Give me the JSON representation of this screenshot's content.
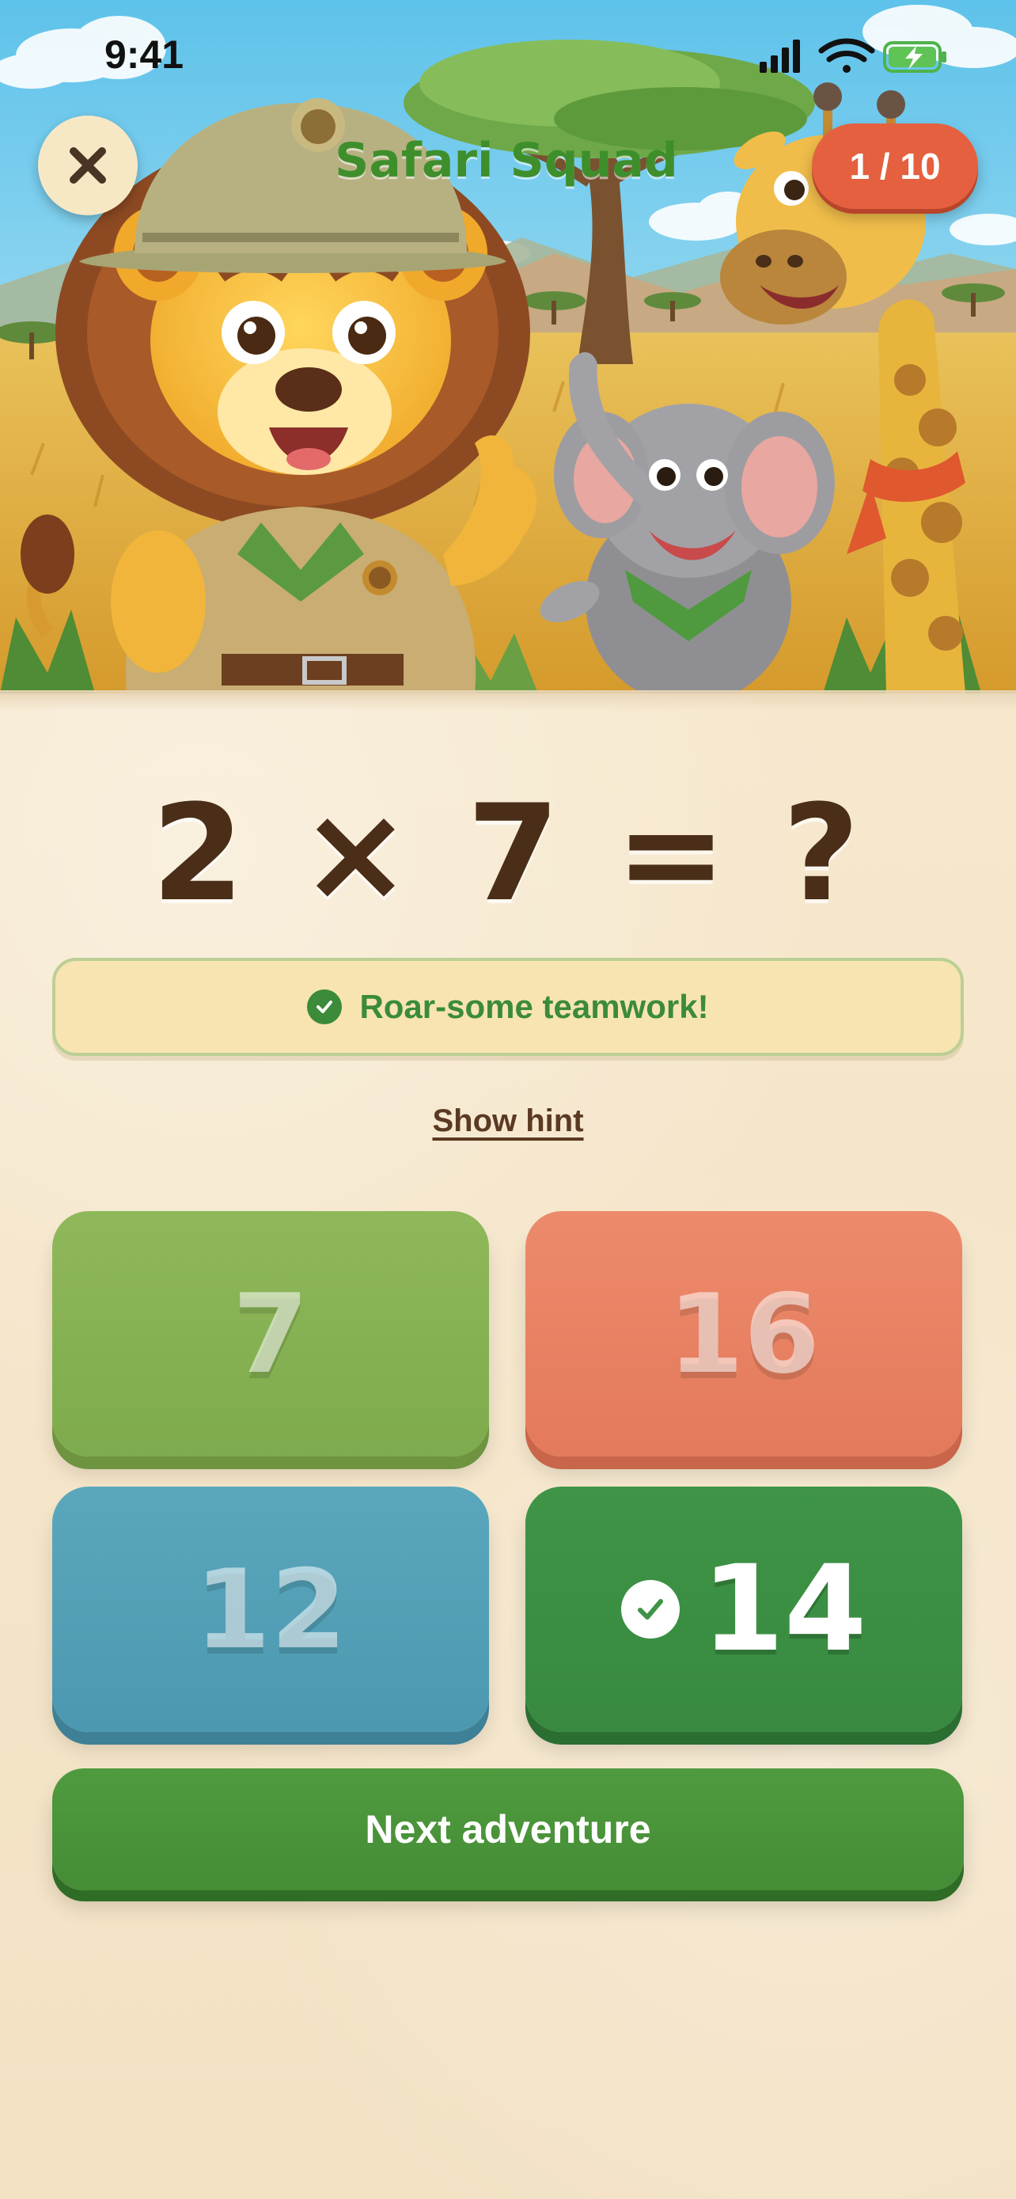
{
  "status_bar": {
    "time": "9:41"
  },
  "header": {
    "title": "Safari Squad",
    "progress": "1 / 10",
    "close_icon": "close-icon"
  },
  "question": {
    "text": "2 × 7 = ?"
  },
  "feedback": {
    "text": "Roar-some teamwork!",
    "icon": "check-circle-icon"
  },
  "hint": {
    "label": "Show hint"
  },
  "answers": [
    {
      "value": "7",
      "color": "#8fb85a",
      "state": "disabled"
    },
    {
      "value": "16",
      "color": "#ed8a6c",
      "state": "disabled"
    },
    {
      "value": "12",
      "color": "#5aa7bd",
      "state": "disabled"
    },
    {
      "value": "14",
      "color": "#3f9447",
      "state": "correct"
    }
  ],
  "next_button": {
    "label": "Next adventure"
  },
  "colors": {
    "brand_green": "#3b8b3a",
    "accent_orange": "#e5603e",
    "paper": "#f6e9cf",
    "text_brown": "#4a2e17"
  }
}
